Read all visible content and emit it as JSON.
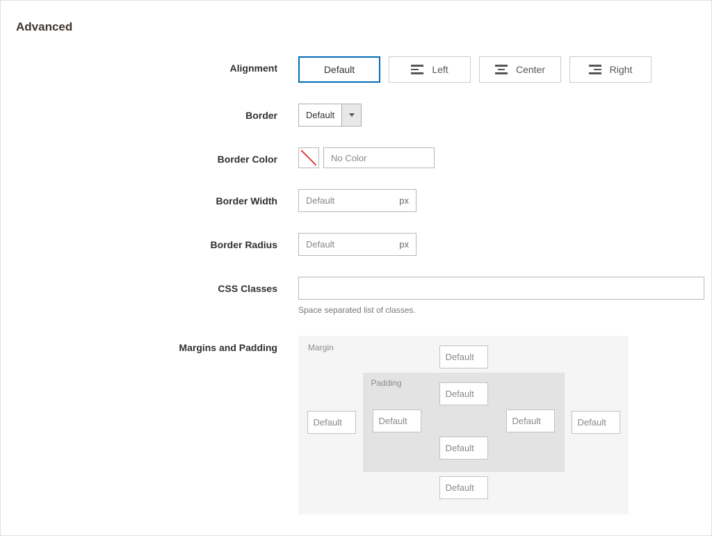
{
  "panel": {
    "title": "Advanced"
  },
  "labels": {
    "alignment": "Alignment",
    "border": "Border",
    "border_color": "Border Color",
    "border_width": "Border Width",
    "border_radius": "Border Radius",
    "css_classes": "CSS Classes",
    "margins_padding": "Margins and Padding"
  },
  "alignment": {
    "options": {
      "default": "Default",
      "left": "Left",
      "center": "Center",
      "right": "Right"
    },
    "selected": "default"
  },
  "border": {
    "value": "Default"
  },
  "border_color": {
    "placeholder": "No Color",
    "value": ""
  },
  "border_width": {
    "placeholder": "Default",
    "unit": "px",
    "value": ""
  },
  "border_radius": {
    "placeholder": "Default",
    "unit": "px",
    "value": ""
  },
  "css_classes": {
    "value": "",
    "hint": "Space separated list of classes."
  },
  "mp": {
    "margin_label": "Margin",
    "padding_label": "Padding",
    "placeholder": "Default",
    "margin": {
      "top": "",
      "right": "",
      "bottom": "",
      "left": ""
    },
    "padding": {
      "top": "",
      "right": "",
      "bottom": "",
      "left": ""
    }
  }
}
